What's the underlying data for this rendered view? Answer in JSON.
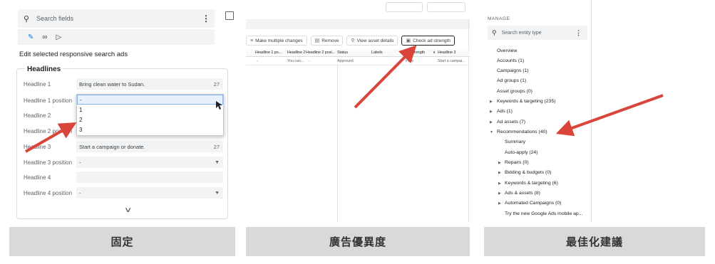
{
  "colors": {
    "arrow": "#d9453a",
    "accent": "#1a73e8",
    "caption_bg": "#d9d9d9"
  },
  "panel1": {
    "search_placeholder": "Search fields",
    "search_icon": "search-icon",
    "more_icon": "more-vert-icon",
    "tabs": [
      "pencil-icon",
      "link-icon",
      "label-icon"
    ],
    "section_title": "Edit selected responsive search ads",
    "group_title": "Headlines",
    "rows": [
      {
        "label": "Headline 1",
        "value": "Bring clean water to Sudan.",
        "count": "27"
      },
      {
        "label": "Headline 1 position",
        "value": "-"
      },
      {
        "label": "Headline 2",
        "value": ""
      },
      {
        "label": "Headline 2 position",
        "value": ""
      },
      {
        "label": "Headline 3",
        "value": "Start a campaign or donate.",
        "count": "27"
      },
      {
        "label": "Headline 3 position",
        "value": "-"
      },
      {
        "label": "Headline 4",
        "value": ""
      },
      {
        "label": "Headline 4 position",
        "value": "-"
      }
    ],
    "dropdown_options": [
      "-",
      "1",
      "2",
      "3"
    ],
    "caption": "固定"
  },
  "panel2": {
    "toolbar": [
      "Make multiple changes",
      "Remove",
      "View asset details",
      "Check ad strength"
    ],
    "columns": [
      "Headline 1 po...",
      "Headline 2",
      "Headline 2 posi...",
      "Status",
      "Labels",
      "Ad strength",
      "Headline 3"
    ],
    "row": [
      "-",
      "You can...",
      "-",
      "Approved",
      "",
      "Poor",
      "Start a campai..."
    ],
    "caption": "廣告優異度"
  },
  "panel3": {
    "manage_label": "MANAGE",
    "search_placeholder": "Search entity type",
    "items": [
      "Overview",
      "Accounts (1)",
      "Campaigns (1)",
      "Ad groups (1)",
      "Asset groups (0)",
      "Keywords & targeting (235)",
      "Ads (1)",
      "Ad assets (7)",
      "Recommendations (40)",
      "Summary",
      "Auto-apply (24)",
      "Repairs (0)",
      "Bidding & budgets (0)",
      "Keywords & targeting (6)",
      "Ads & assets (8)",
      "Automated Campaigns (0)",
      "Try the new Google Ads mobile ap..."
    ],
    "caption": "最佳化建議"
  }
}
